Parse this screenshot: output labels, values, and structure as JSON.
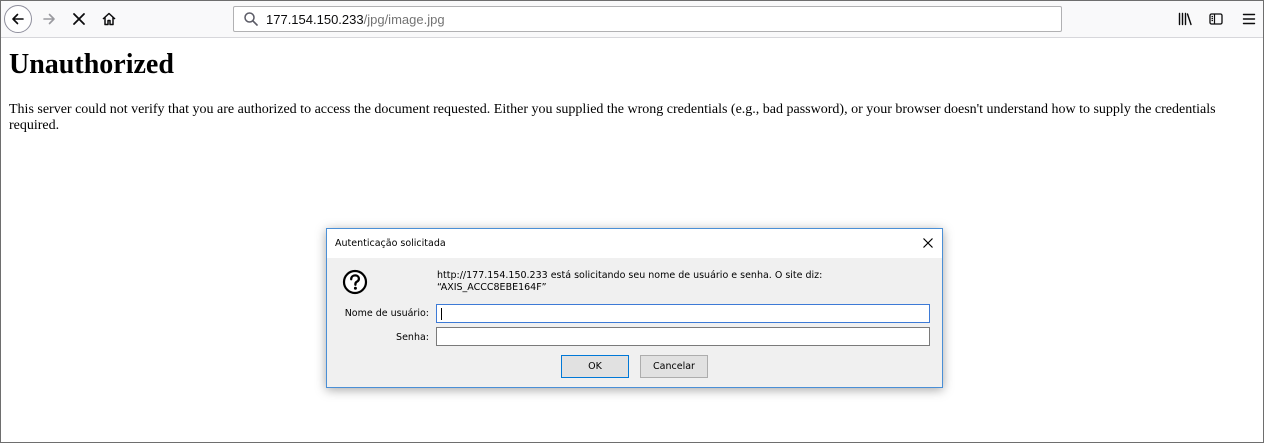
{
  "browser": {
    "url_host": "177.154.150.233",
    "url_path": "/jpg/image.jpg"
  },
  "page": {
    "heading": "Unauthorized",
    "body": "This server could not verify that you are authorized to access the document requested. Either you supplied the wrong credentials (e.g., bad password), or your browser doesn't understand how to supply the credentials required."
  },
  "dialog": {
    "title": "Autenticação solicitada",
    "message_line1": "http://177.154.150.233 está solicitando seu nome de usuário e senha. O site diz:",
    "message_line2": "“AXIS_ACCC8EBE164F”",
    "username_label": "Nome de usuário:",
    "username_value": "",
    "password_label": "Senha:",
    "password_value": "",
    "ok_label": "OK",
    "cancel_label": "Cancelar"
  },
  "icons": {
    "back": "back-arrow-icon",
    "forward": "forward-arrow-icon",
    "stop": "close-icon",
    "home": "home-icon",
    "search": "search-icon",
    "library": "library-icon",
    "sidebar": "sidebar-icon",
    "menu": "hamburger-menu-icon",
    "question": "question-icon"
  }
}
